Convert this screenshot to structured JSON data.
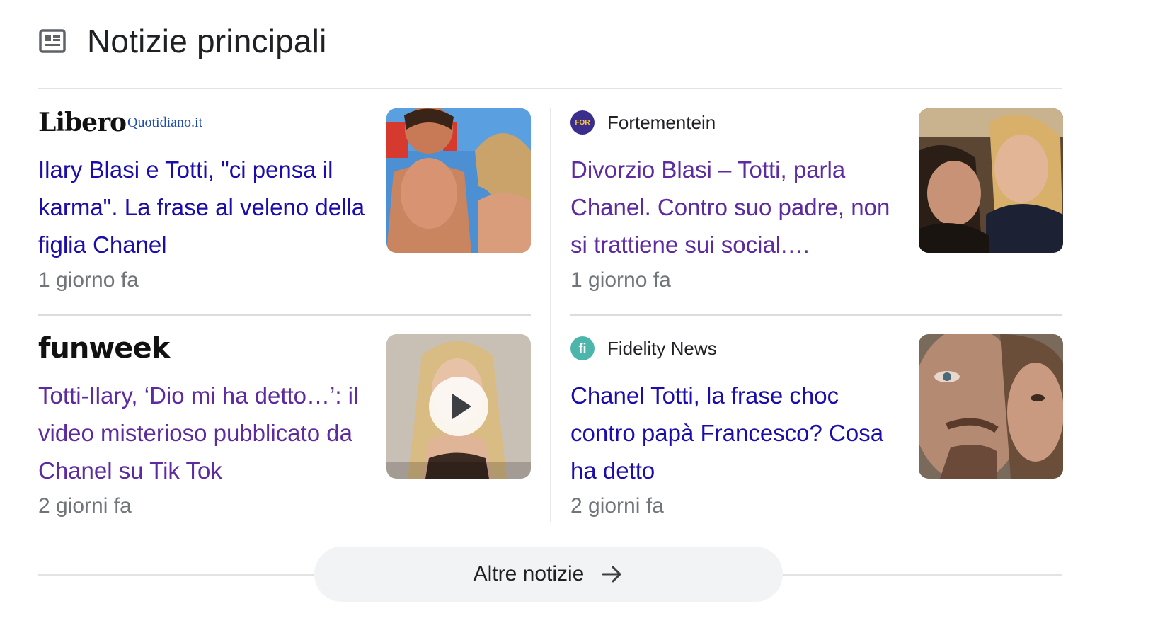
{
  "section": {
    "title": "Notizie principali",
    "icon": "news-article-icon"
  },
  "articles": [
    {
      "source": {
        "logo_main": "Libero",
        "logo_sub": "Quotidiano.it"
      },
      "headline": "Ilary Blasi e Totti, \"ci pensa il karma\". La frase al veleno della figlia Chanel",
      "time": "1 giorno fa",
      "thumbnail": "couple-beach-photo"
    },
    {
      "source": {
        "name": "Fortementein",
        "favicon_text": "FOR",
        "favicon_color": "#3b2d8c"
      },
      "headline": "Divorzio Blasi – Totti, parla Chanel. Contro suo padre, non si trattiene sui social.…",
      "time": "1 giorno fa",
      "thumbnail": "mother-daughter-selfie"
    },
    {
      "source": {
        "logo_main": "funweek"
      },
      "headline": "Totti-Ilary, ‘Dio mi ha detto…’: il video misterioso pubblicato da Chanel su Tik Tok",
      "time": "2 giorni fa",
      "thumbnail": "video-blonde-woman",
      "has_video": true
    },
    {
      "source": {
        "name": "Fidelity News",
        "favicon_text": "fi",
        "favicon_color": "#4db6ac"
      },
      "headline": "Chanel Totti, la frase choc contro papà Francesco? Cosa ha detto",
      "time": "2 giorni fa",
      "thumbnail": "father-daughter-selfie"
    }
  ],
  "more_button": {
    "label": "Altre notizie",
    "icon": "arrow-right-icon"
  },
  "colors": {
    "visited_link": "#5d2a9f",
    "unvisited_link": "#1a0dab",
    "meta_text": "#70757a",
    "button_bg": "#f1f3f4"
  }
}
